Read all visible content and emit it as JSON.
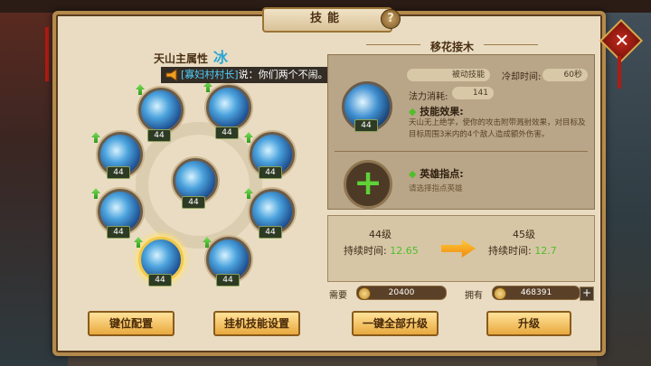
{
  "window": {
    "title": "技能",
    "help_icon": "?",
    "close_icon": "✕"
  },
  "skill_tree": {
    "attribute_label": "天山主属性",
    "attribute_value": "冰",
    "skills": [
      {
        "name": "skill-1",
        "level": "44",
        "upgradable": true
      },
      {
        "name": "skill-2",
        "level": "44",
        "upgradable": true
      },
      {
        "name": "skill-3",
        "level": "44",
        "upgradable": true
      },
      {
        "name": "skill-4",
        "level": "44",
        "upgradable": true
      },
      {
        "name": "skill-5",
        "level": "44",
        "upgradable": false
      },
      {
        "name": "skill-6",
        "level": "44",
        "upgradable": true
      },
      {
        "name": "skill-7",
        "level": "44",
        "upgradable": true
      },
      {
        "name": "skill-8",
        "level": "44",
        "upgradable": true
      },
      {
        "name": "skill-9",
        "level": "44",
        "upgradable": true
      }
    ]
  },
  "announcement": {
    "speaker": "[寡妇村村长]",
    "message": "说：你们两个不闹。行？有什么不能好好说？？"
  },
  "detail": {
    "skill_name": "移花接木",
    "level": "44",
    "trigger_label": "被动技能",
    "cooldown_label": "冷却时间:",
    "cooldown_value": "60秒",
    "mana_label": "法力消耗:",
    "mana_value": "141",
    "effect_title": "技能效果:",
    "effect_desc": "天山无上绝学，使你的攻击附带溅射效果，对目标及目标周围3米内的4个敌人造成额外伤害。",
    "hero_title": "英雄指点:",
    "hero_desc": "请选择指点英雄"
  },
  "compare": {
    "current_level": "44级",
    "next_level": "45级",
    "duration_label": "持续时间:",
    "current_value": "12.65",
    "next_value": "12.7"
  },
  "cost": {
    "need_label": "需要",
    "need_value": "20400",
    "have_label": "拥有",
    "have_value": "468391",
    "add_icon": "+"
  },
  "buttons": {
    "keybind": "键位配置",
    "idle_setting": "挂机技能设置",
    "upgrade_all": "一键全部升级",
    "upgrade": "升级"
  },
  "colors": {
    "accent_gold": "#e8a93e",
    "value_green": "#4fbf2a",
    "element_blue": "#2aa6d6"
  }
}
